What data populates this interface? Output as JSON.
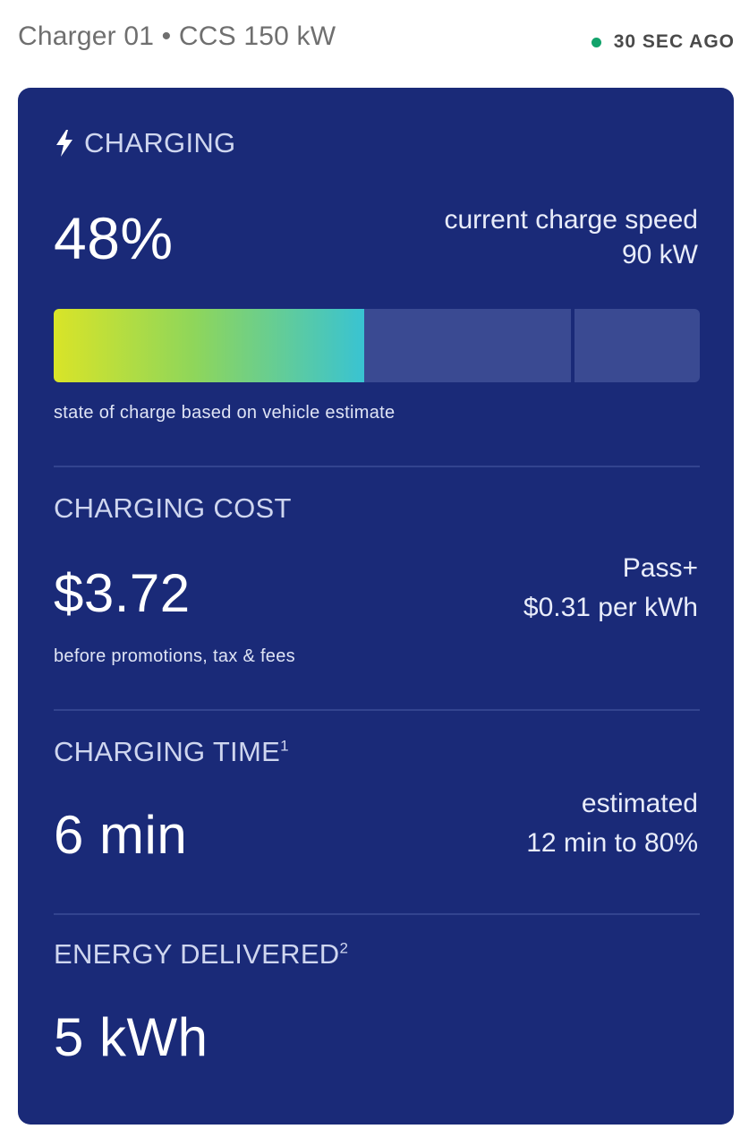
{
  "header": {
    "charger_title": "Charger 01 • CCS 150 kW",
    "status_text": "30 SEC AGO",
    "status_color": "#12a36b"
  },
  "charging": {
    "state_label": "CHARGING",
    "icon": "bolt-icon",
    "percent": "48%",
    "speed_label": "current charge speed",
    "speed_value": "90 kW",
    "progress_fraction": 0.48,
    "bar_note": "state of charge based on vehicle estimate"
  },
  "cost": {
    "label": "CHARGING COST",
    "value": "$3.72",
    "plan": "Pass+",
    "rate": "$0.31 per kWh",
    "note": "before promotions, tax & fees"
  },
  "time": {
    "label": "CHARGING TIME",
    "footnote": "1",
    "value": "6 min",
    "estimate_label": "estimated",
    "estimate_value": "12 min to 80%"
  },
  "energy": {
    "label": "ENERGY DELIVERED",
    "footnote": "2",
    "value": "5 kWh"
  },
  "colors": {
    "card_bg": "#1a2a78",
    "gradient_start": "#d9e428",
    "gradient_end": "#39c3d2"
  }
}
